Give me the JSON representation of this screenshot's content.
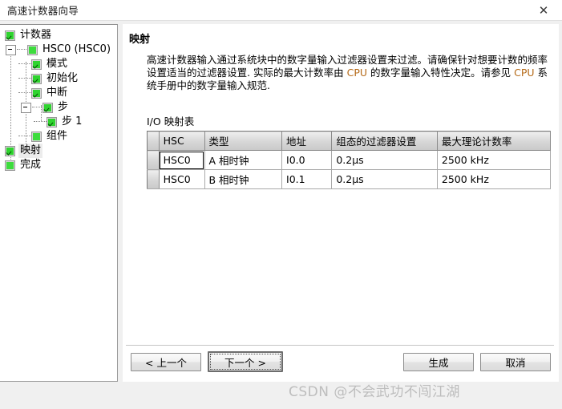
{
  "window": {
    "title": "高速计数器向导",
    "close_icon": "close-icon",
    "close_glyph": "✕"
  },
  "tree": {
    "items": [
      {
        "label": "计数器",
        "state": "checked",
        "depth": 0,
        "selected": false
      },
      {
        "label": "HSC0 (HSC0)",
        "state": "plain",
        "depth": 1,
        "selected": false
      },
      {
        "label": "模式",
        "state": "checked",
        "depth": 2,
        "selected": false
      },
      {
        "label": "初始化",
        "state": "checked",
        "depth": 2,
        "selected": false
      },
      {
        "label": "中断",
        "state": "checked",
        "depth": 2,
        "selected": false
      },
      {
        "label": "步",
        "state": "checked",
        "depth": 2,
        "selected": false
      },
      {
        "label": "步 1",
        "state": "checked",
        "depth": 3,
        "selected": false
      },
      {
        "label": "组件",
        "state": "plain",
        "depth": 2,
        "selected": false
      },
      {
        "label": "映射",
        "state": "checked",
        "depth": 0,
        "selected": true
      },
      {
        "label": "完成",
        "state": "plain",
        "depth": 0,
        "selected": false
      }
    ],
    "step_number": "1"
  },
  "content": {
    "section_title": "映射",
    "description_part1": "高速计数器输入通过系统块中的数字量输入过滤器设置来过滤。请确保针对想要计数的频率设置适当的过滤器设置. 实际的最大计数率由 ",
    "keyword1": "CPU",
    "description_part2": " 的数字量输入特性决定。请参见 ",
    "keyword2": "CPU",
    "description_part3": " 系统手册中的数字量输入规范.",
    "table_label": "I/O 映射表"
  },
  "table": {
    "headers": [
      "HSC",
      "类型",
      "地址",
      "组态的过滤器设置",
      "最大理论计数率"
    ],
    "rows": [
      {
        "hsc": "HSC0",
        "type": "A 相时钟",
        "address": "I0.0",
        "filter": "0.2µs",
        "rate": "2500 kHz",
        "focused": true
      },
      {
        "hsc": "HSC0",
        "type": "B 相时钟",
        "address": "I0.1",
        "filter": "0.2µs",
        "rate": "2500 kHz",
        "focused": false
      }
    ]
  },
  "footer": {
    "prev_label": "< 上一个",
    "next_label": "下一个 >",
    "generate_label": "生成",
    "cancel_label": "取消"
  },
  "watermark": {
    "text": "CSDN @不会武功不闯江湖"
  },
  "colors": {
    "check_green": "#2fd42f",
    "keyword_orange": "#b56a18",
    "dialog_bg": "#f0f0f0",
    "pane_bg": "#ffffff"
  }
}
